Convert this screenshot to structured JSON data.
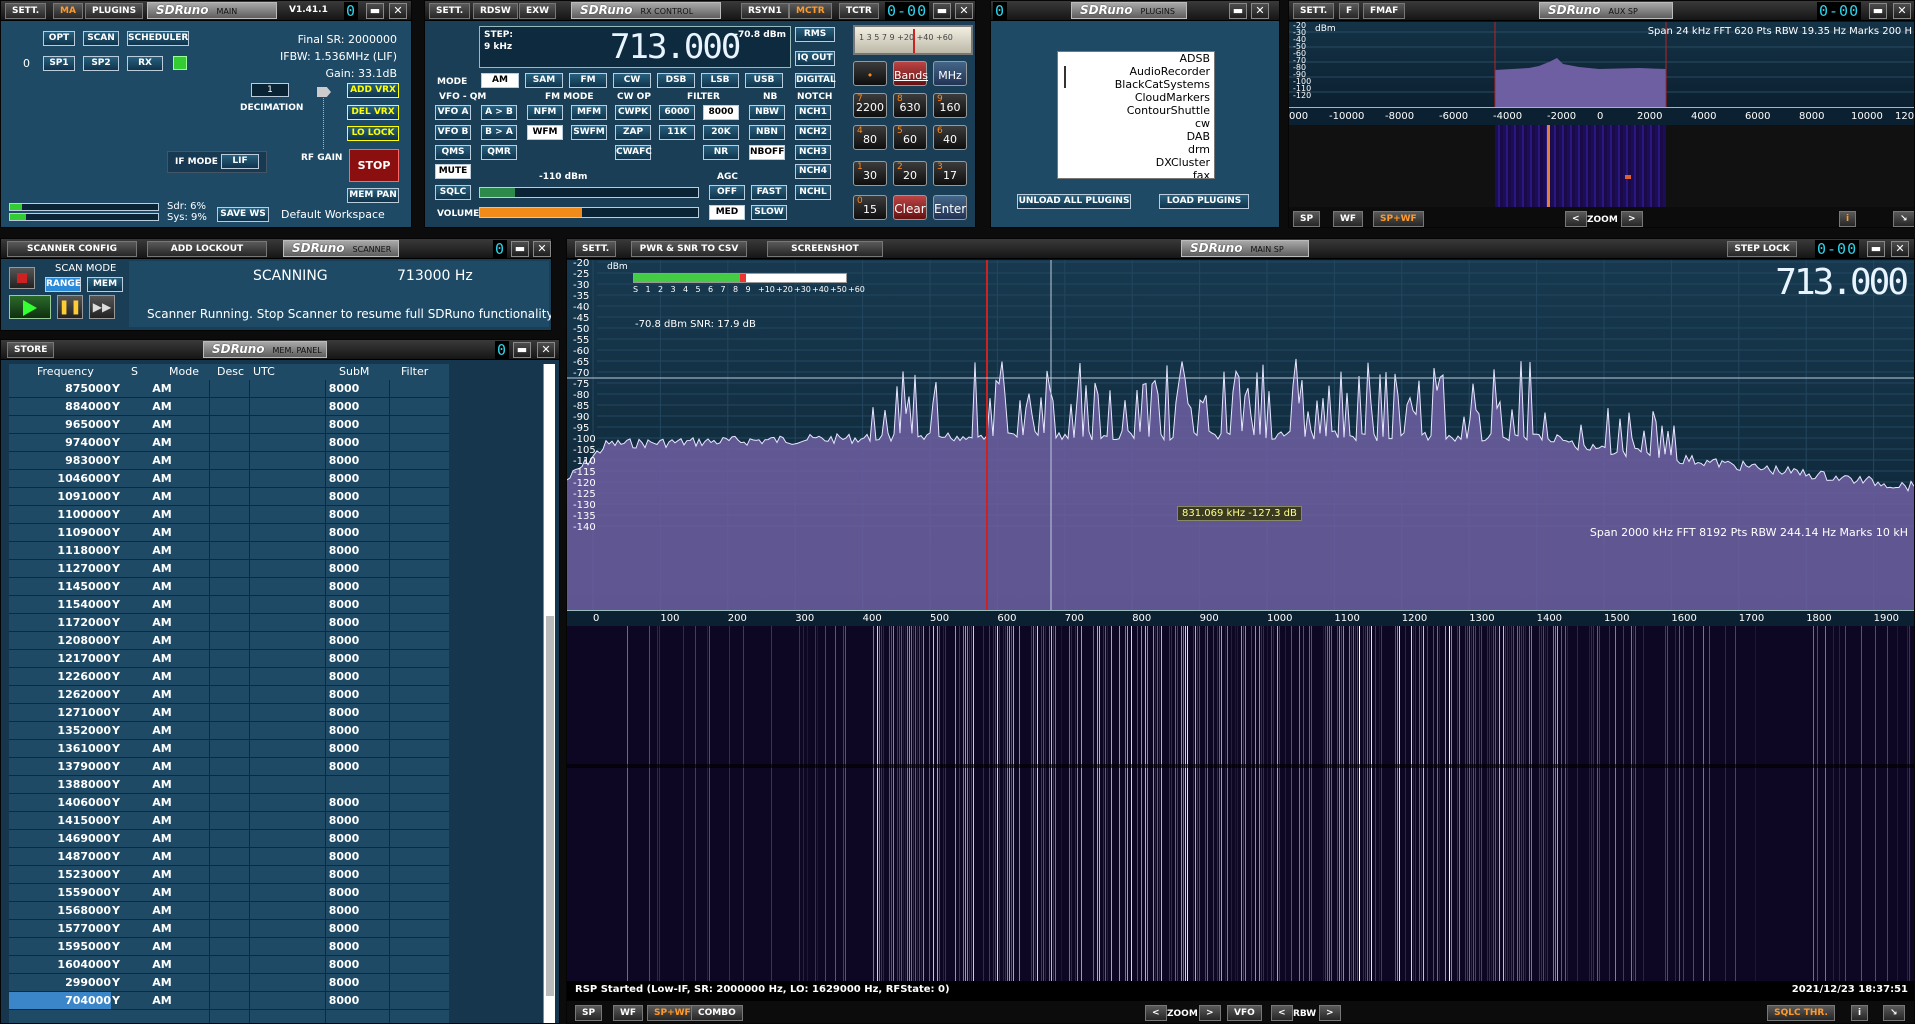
{
  "main": {
    "sett": "SETT.",
    "ma": "MA",
    "plugins": "PLUGINS",
    "brand": "SDRuno",
    "title": "MAIN",
    "version": "V1.41.1",
    "opt": "OPT",
    "scan": "SCAN",
    "scheduler": "SCHEDULER",
    "idx": "0",
    "sp1": "SP1",
    "sp2": "SP2",
    "rx": "RX",
    "final_sr": "Final SR: 2000000",
    "ifbw": "IFBW: 1.536MHz (LIF)",
    "gain": "Gain: 33.1dB",
    "decim_value": "1",
    "decimation": "DECIMATION",
    "add_vrx": "ADD VRX",
    "del_vrx": "DEL VRX",
    "lo_lock": "LO LOCK",
    "ifmode_label": "IF MODE",
    "ifmode_value": "LIF",
    "rfgain": "RF GAIN",
    "stop": "STOP",
    "mem_pan": "MEM PAN",
    "sdr": "Sdr: 6%",
    "sys": "Sys: 9%",
    "save_ws": "SAVE WS",
    "workspace": "Default Workspace"
  },
  "rx": {
    "sett": "SETT.",
    "rdsw": "RDSW",
    "exw": "EXW",
    "brand": "SDRuno",
    "title": "RX CONTROL",
    "rsyn1": "RSYN1",
    "mctr": "MCTR",
    "tctr": "TCTR",
    "step_label": "STEP:",
    "step_value": "9 kHz",
    "dbm": "-70.8 dBm",
    "freq": "713.000",
    "rms": "RMS",
    "iq_out": "IQ OUT",
    "digital": "DIGITAL",
    "mode": "MODE",
    "modes": [
      "AM",
      "SAM",
      "FM",
      "CW",
      "DSB",
      "LSB",
      "USB"
    ],
    "vfo_qm": "VFO - QM",
    "fm_mode": "FM MODE",
    "cw_op": "CW OP",
    "filter": "FILTER",
    "nb": "NB",
    "notch": "NOTCH",
    "vfo_a": "VFO A",
    "a_to_b": "A > B",
    "nfm": "NFM",
    "mfm": "MFM",
    "cwpk": "CWPK",
    "f6000": "6000",
    "f8000": "8000",
    "nbw": "NBW",
    "nch1": "NCH1",
    "vfo_b": "VFO B",
    "b_to_a": "B > A",
    "wfm": "WFM",
    "swfm": "SWFM",
    "zap": "ZAP",
    "f11k": "11K",
    "f20k": "20K",
    "nbn": "NBN",
    "nch2": "NCH2",
    "qms": "QMS",
    "qmr": "QMR",
    "cwafc": "CWAFC",
    "nr": "NR",
    "nboff": "NBOFF",
    "nch3": "NCH3",
    "mute": "MUTE",
    "sql_db": "-110 dBm",
    "agc": "AGC",
    "nch4": "NCH4",
    "sqlc": "SQLC",
    "off": "OFF",
    "fast": "FAST",
    "nchl": "NCHL",
    "volume": "VOLUME",
    "med": "MED",
    "slow": "SLOW",
    "meter_ticks": "1 3 5 7 9 +20 +40 +60",
    "bands": "Bands",
    "mhz": "MHz",
    "dot": "•",
    "clear": "Clear",
    "enter": "Enter",
    "keys": [
      {
        "d": "7",
        "v": "2200"
      },
      {
        "d": "8",
        "v": "630"
      },
      {
        "d": "9",
        "v": "160"
      },
      {
        "d": "4",
        "v": "80"
      },
      {
        "d": "5",
        "v": "60"
      },
      {
        "d": "6",
        "v": "40"
      },
      {
        "d": "1",
        "v": "30"
      },
      {
        "d": "2",
        "v": "20"
      },
      {
        "d": "3",
        "v": "17"
      },
      {
        "d": "0",
        "v": "15"
      }
    ]
  },
  "plugins": {
    "brand": "SDRuno",
    "title": "PLUGINS",
    "items": [
      "ADSB",
      "AudioRecorder",
      "BlackCatSystems",
      "CloudMarkers",
      "ContourShuttle",
      "cw",
      "DAB",
      "drm",
      "DXCluster",
      "fax"
    ],
    "unload": "UNLOAD ALL PLUGINS",
    "load": "LOAD PLUGINS"
  },
  "aux": {
    "sett": "SETT.",
    "f": "F",
    "fmaf": "FMAF",
    "brand": "SDRuno",
    "title": "AUX SP",
    "info": "Span 24 kHz   FFT 620 Pts   RBW 19.35 Hz   Marks 200 H",
    "dbm": "dBm",
    "yticks": [
      "-20",
      "-30",
      "-40",
      "-50",
      "-60",
      "-70",
      "-80",
      "-90",
      "-100",
      "-110",
      "-120"
    ],
    "xticks": [
      "000",
      "-10000",
      "-8000",
      "-6000",
      "-4000",
      "-2000",
      "0",
      "2000",
      "4000",
      "6000",
      "8000",
      "10000",
      "120"
    ],
    "sp": "SP",
    "wf": "WF",
    "spwf": "SP+WF",
    "zoom": "ZOOM",
    "i": "i"
  },
  "scanner": {
    "config": "SCANNER CONFIG",
    "add_lockout": "ADD LOCKOUT",
    "brand": "SDRuno",
    "title": "SCANNER",
    "scan_mode": "SCAN MODE",
    "range": "RANGE",
    "mem": "MEM",
    "status": "SCANNING",
    "freq": "713000 Hz",
    "message": "Scanner Running. Stop Scanner to resume full SDRuno functionality"
  },
  "mem": {
    "store": "STORE",
    "brand": "SDRuno",
    "title": "MEM. PANEL",
    "headers": [
      "Frequency",
      "S",
      "Mode",
      "Desc",
      "UTC",
      "SubM",
      "Filter"
    ],
    "rows": [
      [
        "875000",
        "Y",
        "AM",
        "8000"
      ],
      [
        "884000",
        "Y",
        "AM",
        "8000"
      ],
      [
        "965000",
        "Y",
        "AM",
        "8000"
      ],
      [
        "974000",
        "Y",
        "AM",
        "8000"
      ],
      [
        "983000",
        "Y",
        "AM",
        "8000"
      ],
      [
        "1046000",
        "Y",
        "AM",
        "8000"
      ],
      [
        "1091000",
        "Y",
        "AM",
        "8000"
      ],
      [
        "1100000",
        "Y",
        "AM",
        "8000"
      ],
      [
        "1109000",
        "Y",
        "AM",
        "8000"
      ],
      [
        "1118000",
        "Y",
        "AM",
        "8000"
      ],
      [
        "1127000",
        "Y",
        "AM",
        "8000"
      ],
      [
        "1145000",
        "Y",
        "AM",
        "8000"
      ],
      [
        "1154000",
        "Y",
        "AM",
        "8000"
      ],
      [
        "1172000",
        "Y",
        "AM",
        "8000"
      ],
      [
        "1208000",
        "Y",
        "AM",
        "8000"
      ],
      [
        "1217000",
        "Y",
        "AM",
        "8000"
      ],
      [
        "1226000",
        "Y",
        "AM",
        "8000"
      ],
      [
        "1262000",
        "Y",
        "AM",
        "8000"
      ],
      [
        "1271000",
        "Y",
        "AM",
        "8000"
      ],
      [
        "1352000",
        "Y",
        "AM",
        "8000"
      ],
      [
        "1361000",
        "Y",
        "AM",
        "8000"
      ],
      [
        "1379000",
        "Y",
        "AM",
        "8000"
      ],
      [
        "1388000",
        "Y",
        "AM",
        ""
      ],
      [
        "1406000",
        "Y",
        "AM",
        "8000"
      ],
      [
        "1415000",
        "Y",
        "AM",
        "8000"
      ],
      [
        "1469000",
        "Y",
        "AM",
        "8000"
      ],
      [
        "1487000",
        "Y",
        "AM",
        "8000"
      ],
      [
        "1523000",
        "Y",
        "AM",
        "8000"
      ],
      [
        "1559000",
        "Y",
        "AM",
        "8000"
      ],
      [
        "1568000",
        "Y",
        "AM",
        "8000"
      ],
      [
        "1577000",
        "Y",
        "AM",
        "8000"
      ],
      [
        "1595000",
        "Y",
        "AM",
        "8000"
      ],
      [
        "1604000",
        "Y",
        "AM",
        "8000"
      ],
      [
        "299000",
        "Y",
        "AM",
        "8000"
      ],
      [
        "704000",
        "Y",
        "AM",
        "8000"
      ]
    ]
  },
  "mainsp": {
    "sett": "SETT.",
    "pwr_snr": "PWR & SNR TO CSV",
    "screenshot": "SCREENSHOT",
    "brand": "SDRuno",
    "title": "MAIN SP",
    "step_lock": "STEP LOCK",
    "freq": "713.000",
    "dbm": "dBm",
    "smeter_ticks": [
      "S",
      "1",
      "2",
      "3",
      "4",
      "5",
      "6",
      "7",
      "8",
      "9",
      "+10",
      "+20",
      "+30",
      "+40",
      "+50",
      "+60"
    ],
    "snr": "-70.8 dBm    SNR: 17.9 dB",
    "cursor": "831.069 kHz -127.3 dB",
    "info": "Span 2000 kHz   FFT 8192 Pts   RBW 244.14 Hz   Marks 10 kH",
    "yticks": [
      "-20",
      "-25",
      "-30",
      "-35",
      "-40",
      "-45",
      "-50",
      "-55",
      "-60",
      "-65",
      "-70",
      "-75",
      "-80",
      "-85",
      "-90",
      "-95",
      "-100",
      "-105",
      "-110",
      "-115",
      "-120",
      "-125",
      "-130",
      "-135",
      "-140"
    ],
    "xticks": [
      "0",
      "100",
      "200",
      "300",
      "400",
      "500",
      "600",
      "700",
      "800",
      "900",
      "1000",
      "1100",
      "1200",
      "1300",
      "1400",
      "1500",
      "1600",
      "1700",
      "1800",
      "1900"
    ],
    "status": "RSP Started (Low-IF, SR: 2000000 Hz, LO: 1629000 Hz, RFState: 0)",
    "datetime": "2021/12/23 18:37:51",
    "sp": "SP",
    "wf": "WF",
    "spwf": "SP+WF",
    "combo": "COMBO",
    "zoom": "ZOOM",
    "vfo": "VFO",
    "rbw": "RBW",
    "sqlc_thr": "SQLC THR.",
    "i": "i"
  },
  "colors": {
    "accent": "#ff9a2a",
    "panel": "#1e4a66",
    "seg": "#2fd2e8",
    "stop": "#8b0f0f",
    "spectrum_fill": "#6e5fa2"
  }
}
